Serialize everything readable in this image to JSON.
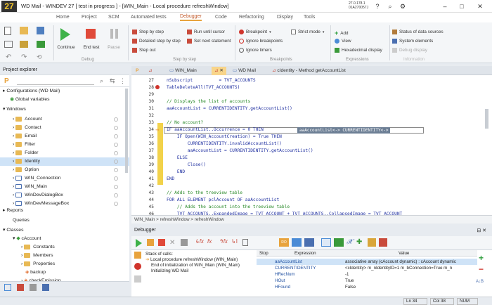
{
  "title_bar": {
    "app_title": "WD Mail - WINDEV 27 [ test in progress ] - [WIN_Main - Local procedure refreshWindow]",
    "version_line1": "27.0.178.1",
    "version_line2": "01A270057J"
  },
  "menu_tabs": [
    "Home",
    "Project",
    "SCM",
    "Automated tests",
    "Debugger",
    "Code",
    "Refactoring",
    "Display",
    "Tools"
  ],
  "active_tab": "Debugger",
  "ribbon": {
    "continue_label": "Continue",
    "end_test_label": "End test",
    "pause_label": "Pause",
    "debug_group": "Debug",
    "step_by_step": "Step by step",
    "detailed_step": "Detailed step by step",
    "step_out": "Step out",
    "run_until_cursor": "Run until cursor",
    "set_next_statement": "Set next statement",
    "step_group": "Step by step",
    "breakpoint": "Breakpoint",
    "strict_mode": "Strict mode",
    "ignore_breakpoints": "Ignore breakpoints",
    "ignore_timers": "Ignore timers",
    "breakpoints_group": "Breakpoints",
    "add": "Add",
    "view": "View",
    "hex_display": "Hexadecimal display",
    "expressions_group": "Expressions",
    "status_of_data_sources": "Status of data sources",
    "system_elements": "System elements",
    "debug_display": "Debug display",
    "information_group": "Information"
  },
  "project_explorer": {
    "header": "Project explorer",
    "rows": [
      {
        "label": "Configurations (WD Mail)",
        "type": "section"
      },
      {
        "label": "Global variables",
        "type": "item"
      },
      {
        "label": "Windows",
        "type": "section"
      },
      {
        "label": "Account",
        "type": "folder"
      },
      {
        "label": "Contact",
        "type": "folder"
      },
      {
        "label": "Email",
        "type": "folder"
      },
      {
        "label": "Filter",
        "type": "folder"
      },
      {
        "label": "Folder",
        "type": "folder"
      },
      {
        "label": "Identity",
        "type": "folder",
        "selected": true
      },
      {
        "label": "Option",
        "type": "folder"
      },
      {
        "label": "WIN_Connection",
        "type": "window"
      },
      {
        "label": "WIN_Main",
        "type": "window"
      },
      {
        "label": "WinDevDialogBox",
        "type": "window"
      },
      {
        "label": "WinDevMessageBox",
        "type": "window"
      },
      {
        "label": "Reports",
        "type": "section"
      },
      {
        "label": "Queries",
        "type": "item"
      },
      {
        "label": "Classes",
        "type": "section"
      },
      {
        "label": "cAccount",
        "type": "class"
      },
      {
        "label": "Constants",
        "type": "sub"
      },
      {
        "label": "Members",
        "type": "sub"
      },
      {
        "label": "Properties",
        "type": "sub"
      },
      {
        "label": "backup",
        "type": "sub"
      },
      {
        "label": "checkEmission",
        "type": "sub"
      }
    ]
  },
  "doc_tabs": [
    "WIN_Main",
    "WD Mail",
    "cIdentity - Method getAccountList"
  ],
  "editor": {
    "lines": [
      {
        "n": "27",
        "t": "nSubscript          = TVT_ACCOUNTS"
      },
      {
        "n": "28",
        "t": "TableDeleteAll(TVT_ACCOUNTS)"
      },
      {
        "n": "29",
        "t": ""
      },
      {
        "n": "30",
        "t": "// Displays the list of accounts",
        "c": true
      },
      {
        "n": "31",
        "t": "aaAccountList = CURRENTIDENTITY.getAccountList()"
      },
      {
        "n": "32",
        "t": ""
      },
      {
        "n": "33",
        "t": "// No account?",
        "c": true
      },
      {
        "n": "34",
        "t": "IF aaAccountList..Occurrence = 0 THEN"
      },
      {
        "n": "35",
        "t": "    IF Open(WIN_AccountCreation) = True THEN"
      },
      {
        "n": "36",
        "t": "        CURRENTIDENTITY.invalidAccountList()"
      },
      {
        "n": "37",
        "t": "        aaAccountList = CURRENTIDENTITY.getAccountList()"
      },
      {
        "n": "38",
        "t": "    ELSE"
      },
      {
        "n": "39",
        "t": "        Close()"
      },
      {
        "n": "40",
        "t": "    END"
      },
      {
        "n": "41",
        "t": "END"
      },
      {
        "n": "42",
        "t": ""
      },
      {
        "n": "43",
        "t": "// Adds to the treeview table",
        "c": true
      },
      {
        "n": "44",
        "t": "FOR ALL ELEMENT pclAccount OF aaAccountList"
      },
      {
        "n": "45",
        "t": "    // Adds the account into the treeview table",
        "c": true
      },
      {
        "n": "46",
        "t": "    TVT_ACCOUNTS..ExpandedImage = TVT_ACCOUNT + TVT_ACCOUNTS..CollapsedImage = TVT_ACCOUNT"
      }
    ],
    "tooltip": "aaAccountList<-> CURRENTIDENTITY<->"
  },
  "breadcrumb": "WIN_Main > refreshWindow > refreshWindow",
  "debugger": {
    "header": "Debugger",
    "stack_title": "Stack of calls:",
    "stack": [
      "Local procedure refreshWindow (WIN_Main)",
      "End of initialization of WIN_Main (WIN_Main)",
      "Initializing WD Mail"
    ],
    "columns": [
      "Stop",
      "Expression",
      "Value"
    ],
    "rows": [
      {
        "e": "aaAccountList",
        "v": "associative array (cAccount dynamic) : cAccount dynamic"
      },
      {
        "e": "CURRENTIDENTITY",
        "v": "<cIdentity> m_nIdentityID=1 m_bConnection=True m_n"
      },
      {
        "e": "HRecNum",
        "v": "-1"
      },
      {
        "e": "HOut",
        "v": "True"
      },
      {
        "e": "HFound",
        "v": "False"
      }
    ]
  },
  "status": {
    "line": "Ln 34",
    "col": "Col 38",
    "mode": "NUM"
  }
}
